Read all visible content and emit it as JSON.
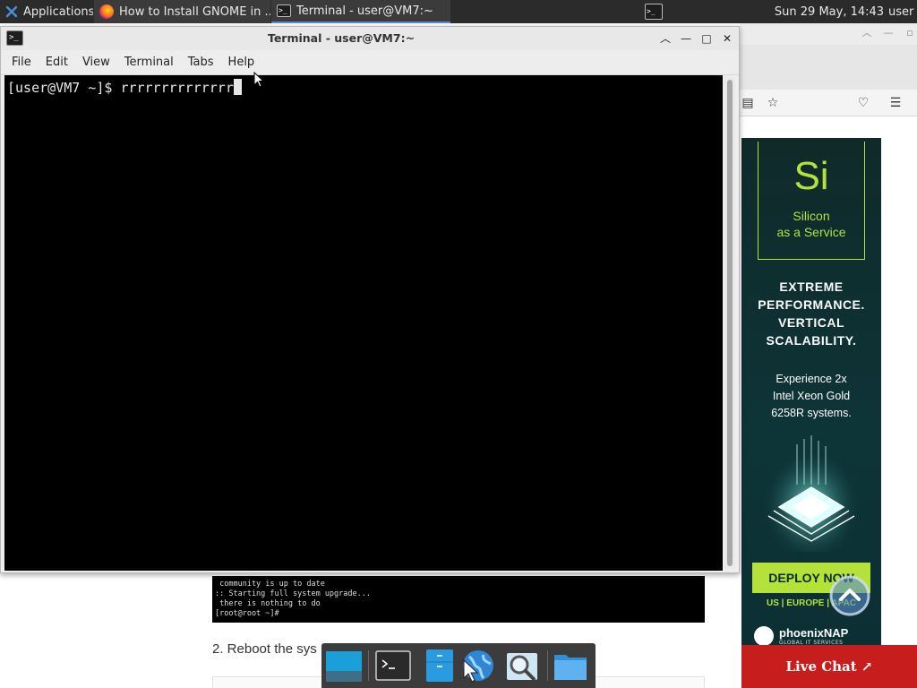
{
  "panel": {
    "apps_label": "Applications",
    "apps_glyph": "☰",
    "firefox_task": "How to Install GNOME in ...",
    "terminal_task": "Terminal - user@VM7:~",
    "clock": "Sun 29 May, 14:43",
    "user": "user"
  },
  "terminal": {
    "title": "Terminal - user@VM7:~",
    "menu": [
      "File",
      "Edit",
      "View",
      "Terminal",
      "Tabs",
      "Help"
    ],
    "prompt": "[user@VM7 ~]$ ",
    "input": "rrrrrrrrrrrrrr"
  },
  "browser": {
    "ad": {
      "symbol": "Si",
      "name_line1": "Silicon",
      "name_line2": "as a Service",
      "headline": [
        "EXTREME",
        "PERFORMANCE.",
        "VERTICAL",
        "SCALABILITY."
      ],
      "body": [
        "Experience 2x",
        "Intel Xeon Gold",
        "6258R systems."
      ],
      "cta": "DEPLOY NOW",
      "regions": "US | EUROPE | APAC",
      "brand": "phoenixNAP",
      "brand_sub": "GLOBAL IT SERVICES"
    },
    "live_chat": "Live Chat ↗"
  },
  "article": {
    "code_lines": [
      " community is up to date",
      ":: Starting full system upgrade...",
      " there is nothing to do",
      "[root@root ~]#"
    ],
    "step_text": "2. Reboot the sys"
  },
  "colors": {
    "accent_green": "#b4e23a",
    "live_chat_red": "#c81d1d",
    "terminal_bg": "#000000"
  }
}
